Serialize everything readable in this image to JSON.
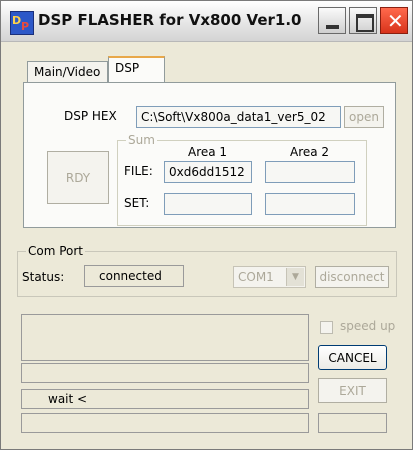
{
  "window": {
    "title": "DSP FLASHER for Vx800  Ver1.0",
    "icon": "dsp-flasher-app-icon",
    "controls": {
      "minimize": "minimize-icon",
      "maximize": "maximize-icon",
      "close": "close-icon",
      "close_glyph": "✕"
    }
  },
  "tabs": [
    {
      "label": "Main/Video",
      "selected": false
    },
    {
      "label": "DSP",
      "selected": true
    }
  ],
  "dsp": {
    "hex_label": "DSP HEX",
    "hex_value": "C:\\Soft\\Vx800a_data1_ver5_02",
    "open_label": "open",
    "rdy_label": "RDY",
    "sum": {
      "group_title": "Sum",
      "area1_header": "Area 1",
      "area2_header": "Area 2",
      "file_label": "FILE:",
      "set_label": "SET:",
      "file_area1": "0xd6dd1512",
      "file_area2": "",
      "set_area1": "",
      "set_area2": ""
    }
  },
  "comport": {
    "group_title": "Com Port",
    "status_label": "Status:",
    "status_value": "connected",
    "port_selected": "COM1",
    "disconnect_label": "disconnect"
  },
  "bottom": {
    "speed_up_label": "speed up",
    "cancel_label": "CANCEL",
    "exit_label": "EXIT",
    "wait_text": "wait  <"
  }
}
